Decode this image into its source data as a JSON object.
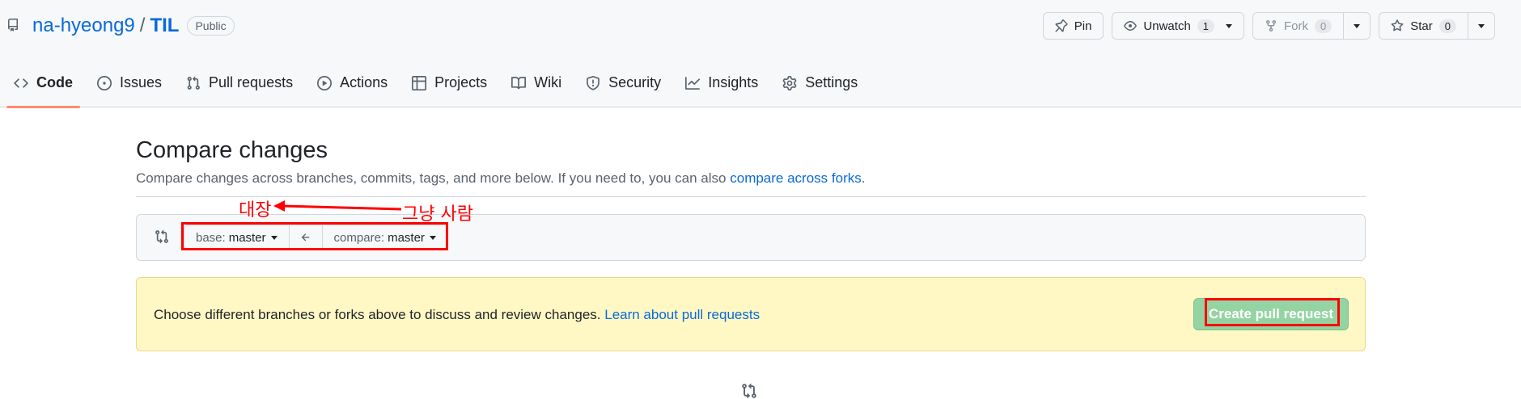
{
  "repo": {
    "owner": "na-hyeong9",
    "separator": "/",
    "name": "TIL",
    "visibility": "Public"
  },
  "actions": {
    "pin_label": "Pin",
    "unwatch_label": "Unwatch",
    "unwatch_count": "1",
    "fork_label": "Fork",
    "fork_count": "0",
    "star_label": "Star",
    "star_count": "0"
  },
  "tabs": [
    {
      "label": "Code",
      "icon": "code-icon",
      "selected": true
    },
    {
      "label": "Issues",
      "icon": "issue-icon"
    },
    {
      "label": "Pull requests",
      "icon": "pull-request-icon"
    },
    {
      "label": "Actions",
      "icon": "play-icon"
    },
    {
      "label": "Projects",
      "icon": "table-icon"
    },
    {
      "label": "Wiki",
      "icon": "book-icon"
    },
    {
      "label": "Security",
      "icon": "shield-icon"
    },
    {
      "label": "Insights",
      "icon": "graph-icon"
    },
    {
      "label": "Settings",
      "icon": "gear-icon"
    }
  ],
  "compare": {
    "title": "Compare changes",
    "subtitle_text": "Compare changes across branches, commits, tags, and more below. If you need to, you can also ",
    "subtitle_link": "compare across forks",
    "subtitle_end": ".",
    "base_label": "base:",
    "base_value": "master",
    "compare_label": "compare:",
    "compare_value": "master"
  },
  "flash": {
    "text": "Choose different branches or forks above to discuss and review changes. ",
    "link": "Learn about pull requests",
    "button": "Create pull request"
  },
  "annotations": {
    "base_note": "대장",
    "compare_note": "그냥 사람",
    "color": "#ff0000"
  },
  "colors": {
    "accent_tab": "#fd8c73",
    "link": "#0969da",
    "flash_bg": "#fff8c5",
    "button_green_disabled": "#94d3a2"
  }
}
